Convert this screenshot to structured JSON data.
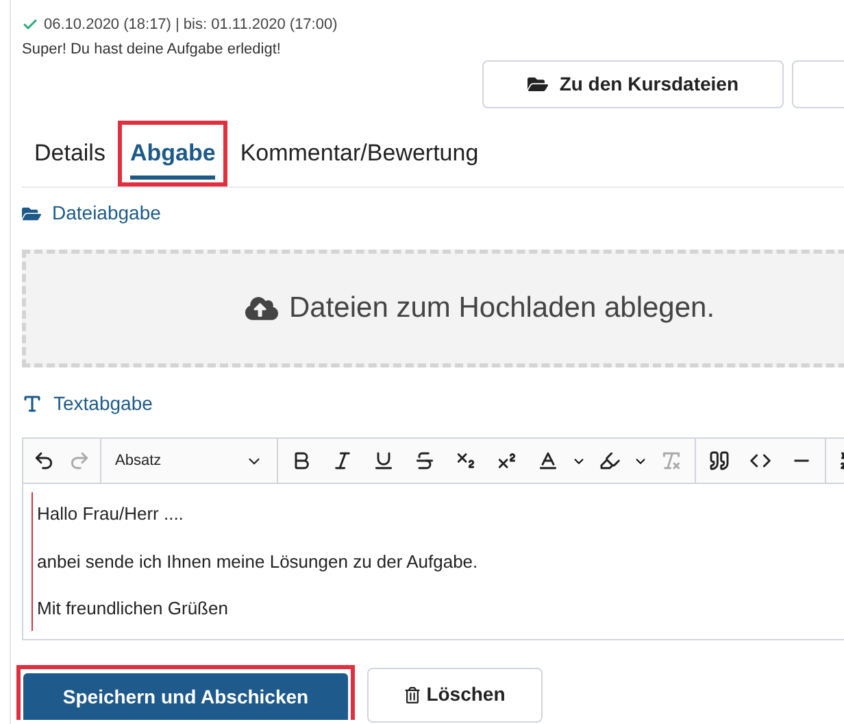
{
  "status": {
    "dates": "06.10.2020 (18:17) | bis: 01.11.2020 (17:00)",
    "message": "Super! Du hast deine Aufgabe erledigt!"
  },
  "header_buttons": [
    {
      "label": "Zu den Kursdateien"
    }
  ],
  "tabs": [
    {
      "label": "Details",
      "selected": false,
      "highlighted": false
    },
    {
      "label": "Abgabe",
      "selected": true,
      "highlighted": true
    },
    {
      "label": "Kommentar/Bewertung",
      "selected": false,
      "highlighted": false
    }
  ],
  "file_section": {
    "title": "Dateiabgabe",
    "dropzone": "Dateien zum Hochladen ablegen."
  },
  "text_section": {
    "title": "Textabgabe",
    "block_format": "Absatz",
    "paragraphs": [
      "Hallo Frau/Herr ....",
      "anbei sende ich Ihnen meine Lösungen zu der Aufgabe.",
      "Mit freundlichen Grüßen"
    ]
  },
  "actions": [
    {
      "label": "Speichern und Abschicken",
      "kind": "primary",
      "highlighted": true
    },
    {
      "label": "Löschen",
      "kind": "delete",
      "highlighted": false
    }
  ]
}
